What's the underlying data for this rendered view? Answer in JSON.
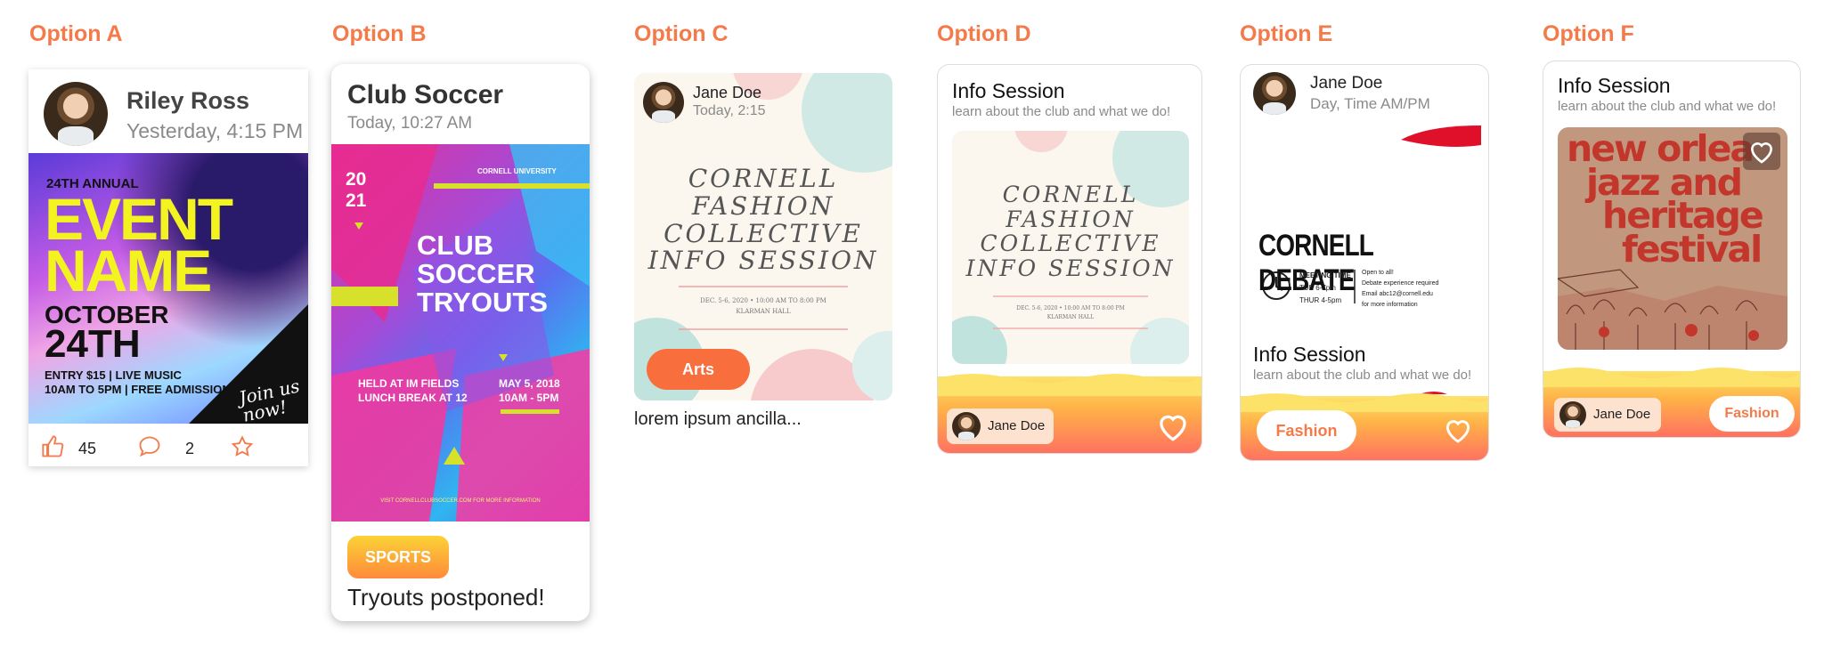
{
  "options": {
    "a": "Option A",
    "b": "Option B",
    "c": "Option C",
    "d": "Option D",
    "e": "Option E",
    "f": "Option F"
  },
  "card_a": {
    "author": "Riley Ross",
    "time": "Yesterday, 4:15 PM",
    "poster": {
      "line1": "24TH ANNUAL",
      "line2": "EVENT",
      "line3": "NAME",
      "line4": "OCTOBER",
      "line5": "24TH",
      "line6": "ENTRY $15 | LIVE MUSIC",
      "line7": "10AM TO 5PM | FREE ADMISSION",
      "script": "Join us now!"
    },
    "likes": "45",
    "comments": "2"
  },
  "card_b": {
    "title": "Club Soccer",
    "time": "Today, 10:27 AM",
    "poster": {
      "year1": "20",
      "year2": "21",
      "univ": "CORNELL UNIVERSITY",
      "h1": "CLUB",
      "h2": "SOCCER",
      "h3": "TRYOUTS",
      "place1": "HELD AT IM FIELDS",
      "place2": "LUNCH BREAK AT 12",
      "date1": "MAY 5, 2018",
      "date2": "10AM - 5PM",
      "footer": "VISIT CORNELLCLUBSOCCER.COM FOR MORE INFORMATION"
    },
    "tag": "SPORTS",
    "caption": "Tryouts postponed!"
  },
  "card_c": {
    "author": "Jane Doe",
    "time": "Today, 2:15",
    "poster": {
      "l1": "CORNELL",
      "l2": "FASHION",
      "l3": "COLLECTIVE",
      "l4": "INFO SESSION",
      "date": "DEC. 5-6, 2020 • 10:00 AM TO 8:00 PM",
      "place": "KLARMAN HALL"
    },
    "tag": "Arts",
    "caption": "lorem ipsum ancilla..."
  },
  "card_d": {
    "title": "Info Session",
    "subtitle": "learn about the club and what we do!",
    "poster": {
      "l1": "CORNELL",
      "l2": "FASHION",
      "l3": "COLLECTIVE",
      "l4": "INFO SESSION",
      "date": "DEC. 5-6, 2020 • 10:00 AM TO 8:00 PM",
      "place": "KLARMAN HALL"
    },
    "author": "Jane Doe"
  },
  "card_e": {
    "author": "Jane Doe",
    "time": "Day, Time AM/PM",
    "poster": {
      "title": "CORNELL DEBATE",
      "meet": "MEETING TIME",
      "tue": "TUE 6-7pm",
      "thu": "THUR 4-5pm",
      "i1": "Open to all!",
      "i2": "Debate experience required",
      "i3": "Email abc12@cornell.edu",
      "i4": "for more information"
    },
    "title": "Info Session",
    "subtitle": "learn about the club and what we do!",
    "tag": "Fashion"
  },
  "card_f": {
    "title": "Info Session",
    "subtitle": "learn about the club and what we do!",
    "poster": {
      "l1": "new orlea",
      "l2": "jazz and",
      "l3": "heritage",
      "l4": "festival"
    },
    "author": "Jane Doe",
    "tag": "Fashion"
  },
  "colors": {
    "accent": "#f47a4a",
    "gradient_top": "#fde26a",
    "gradient_bottom": "#ff6f61"
  }
}
